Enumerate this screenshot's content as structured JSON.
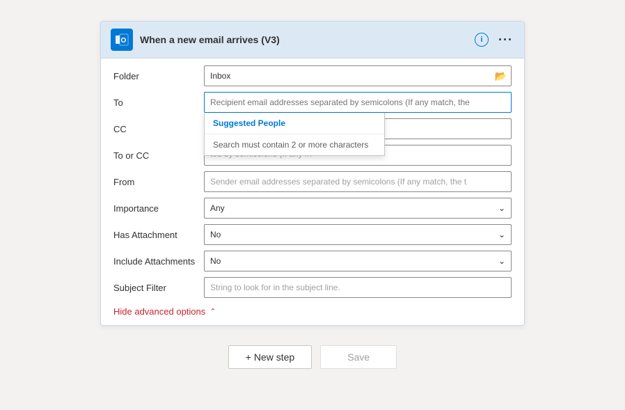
{
  "header": {
    "title": "When a new email arrives (V3)",
    "outlook_letter": "o",
    "info_label": "i",
    "ellipsis_label": "···"
  },
  "fields": {
    "folder_label": "Folder",
    "folder_value": "Inbox",
    "to_label": "To",
    "to_placeholder": "Recipient email addresses separated by semicolons (If any match, the",
    "cc_label": "CC",
    "cc_placeholder": "y semicolons (If any match,",
    "to_or_cc_label": "To or CC",
    "to_or_cc_placeholder": "ted by semicolons (If any m",
    "from_label": "From",
    "from_placeholder": "Sender email addresses separated by semicolons (If any match, the t",
    "importance_label": "Importance",
    "importance_value": "Any",
    "has_attachment_label": "Has Attachment",
    "has_attachment_value": "No",
    "include_attachments_label": "Include Attachments",
    "include_attachments_value": "No",
    "subject_filter_label": "Subject Filter",
    "subject_filter_placeholder": "String to look for in the subject line."
  },
  "autocomplete": {
    "suggested_people_label": "Suggested People",
    "hint_text": "Search must contain 2 or more characters"
  },
  "hide_options_label": "Hide advanced options",
  "buttons": {
    "new_step_label": "+ New step",
    "save_label": "Save"
  }
}
